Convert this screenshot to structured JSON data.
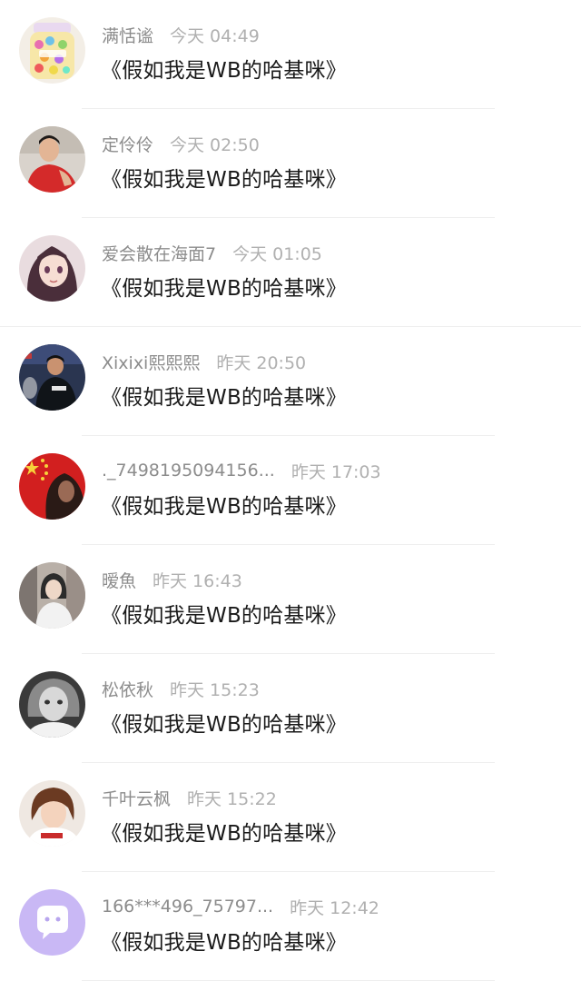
{
  "comments": [
    {
      "name": "满恬谧",
      "time": "今天 04:49",
      "text": "《假如我是WB的哈基咪》",
      "avatar": "candy-jar-avatar",
      "colors": [
        "#f7e7a8",
        "#e86fb0"
      ]
    },
    {
      "name": "定伶伶",
      "time": "今天 02:50",
      "text": "《假如我是WB的哈基咪》",
      "avatar": "man-red-hoodie-avatar",
      "colors": [
        "#d9d3cc",
        "#d42a2a"
      ]
    },
    {
      "name": "爱会散在海面7",
      "time": "今天 01:05",
      "text": "《假如我是WB的哈基咪》",
      "avatar": "anime-girl-avatar",
      "colors": [
        "#e9dcdf",
        "#4a2e3a"
      ]
    },
    {
      "name": "Xixixi熙熙熙",
      "time": "昨天 20:50",
      "text": "《假如我是WB的哈基咪》",
      "avatar": "table-tennis-player-avatar",
      "colors": [
        "#2a3550",
        "#101418"
      ]
    },
    {
      "name": "._7498195094156...",
      "time": "昨天 17:03",
      "text": "《假如我是WB的哈基咪》",
      "avatar": "flag-girl-avatar",
      "colors": [
        "#d21f1f",
        "#2a1a16"
      ]
    },
    {
      "name": "暧魚",
      "time": "昨天 16:43",
      "text": "《假如我是WB的哈基咪》",
      "avatar": "girl-photo-avatar",
      "colors": [
        "#b9b0a8",
        "#2b2b2b"
      ]
    },
    {
      "name": "松依秋",
      "time": "昨天 15:23",
      "text": "《假如我是WB的哈基咪》",
      "avatar": "bw-child-avatar",
      "colors": [
        "#3a3a3a",
        "#d8d8d8"
      ]
    },
    {
      "name": "千叶云枫",
      "time": "昨天 15:22",
      "text": "《假如我是WB的哈基咪》",
      "avatar": "anime-boy-avatar",
      "colors": [
        "#efe8e2",
        "#6b3a22"
      ]
    },
    {
      "name": "166***496_75797...",
      "time": "昨天 12:42",
      "text": "《假如我是WB的哈基咪》",
      "avatar": "chat-bubble-default-avatar",
      "colors": [
        "#c9b8f5",
        "#ffffff"
      ]
    }
  ]
}
